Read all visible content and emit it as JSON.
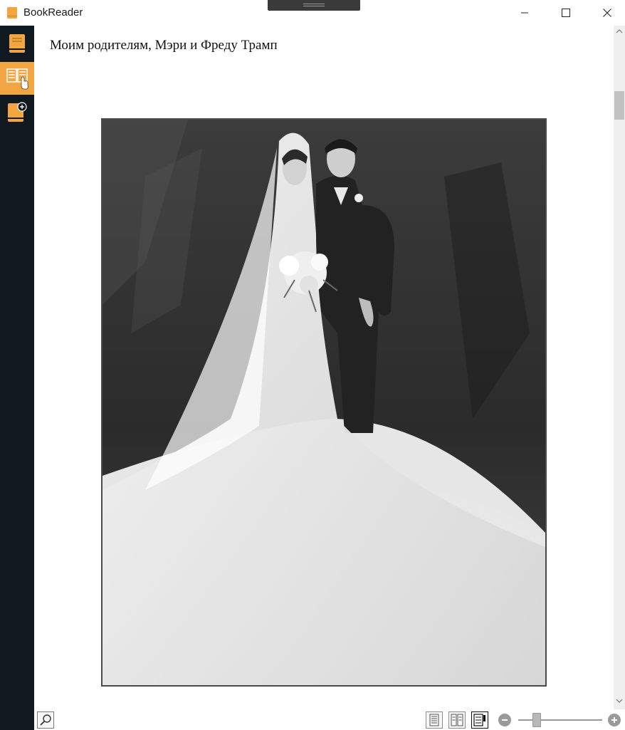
{
  "window": {
    "title": "BookReader"
  },
  "sidebar": {
    "items": [
      {
        "icon": "library-book-icon",
        "selected": false
      },
      {
        "icon": "open-book-reader-icon",
        "selected": true
      },
      {
        "icon": "add-book-icon",
        "selected": false
      }
    ]
  },
  "page": {
    "dedication": "Моим родителям, Мэри и Фреду Трамп",
    "image": "wedding-photograph"
  },
  "statusbar": {
    "view_modes": [
      "single-page",
      "two-page",
      "scroll"
    ],
    "active_view_mode": "scroll",
    "zoom_level_fraction": 0.2
  },
  "colors": {
    "accent": "#f2a541",
    "sidebar_bg": "#101820",
    "page_bg": "#ffffff"
  }
}
